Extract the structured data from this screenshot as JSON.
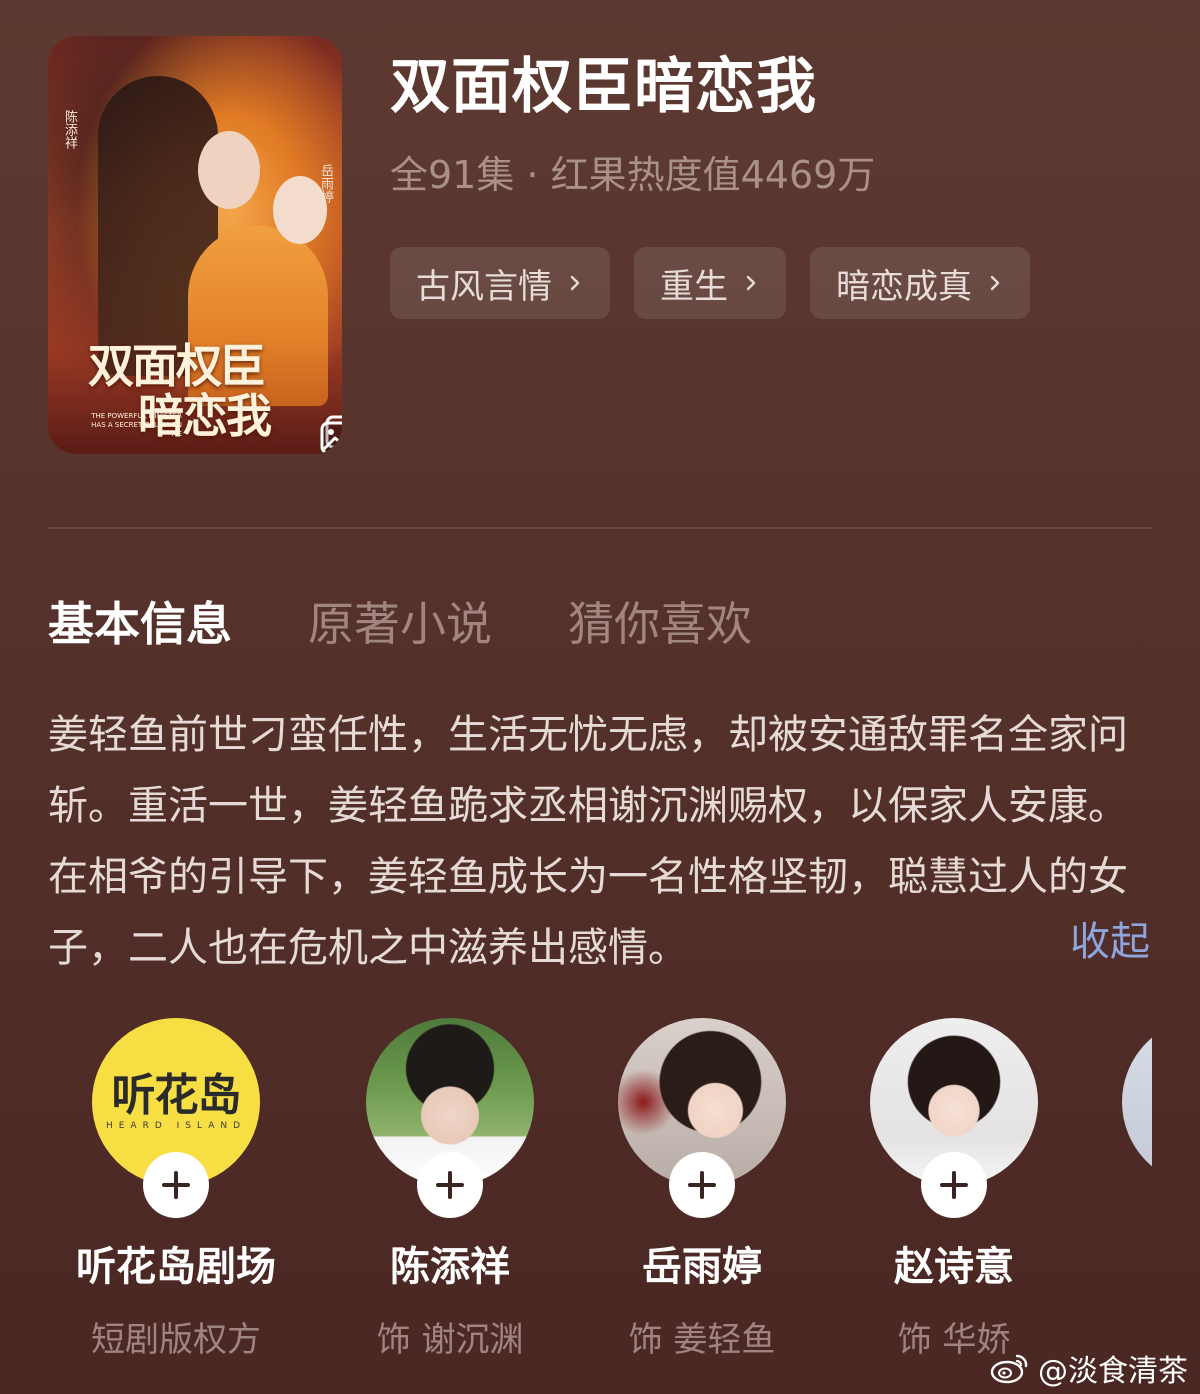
{
  "drama": {
    "title": "双面权臣暗恋我",
    "meta": "全91集 · 红果热度值4469万",
    "poster": {
      "calligraphy_line1": "双面权臣",
      "calligraphy_line2": "暗恋我",
      "english": "THE POWERFUL MINISTER HAS A SECRET CRUSH ON ME",
      "actor_male": "陈添祥",
      "actor_female": "岳雨婷"
    },
    "tags": [
      {
        "label": "古风言情"
      },
      {
        "label": "重生"
      },
      {
        "label": "暗恋成真"
      }
    ]
  },
  "tabs": [
    {
      "label": "基本信息",
      "active": true
    },
    {
      "label": "原著小说",
      "active": false
    },
    {
      "label": "猜你喜欢",
      "active": false
    }
  ],
  "description": "姜轻鱼前世刁蛮任性，生活无忧无虑，却被安通敌罪名全家问斩。重活一世，姜轻鱼跪求丞相谢沉渊赐权，以保家人安康。在相爷的引导下，姜轻鱼成长为一名性格坚韧，聪慧过人的女子，二人也在危机之中滋养出感情。",
  "collapse_label": "收起",
  "cast": [
    {
      "name": "听花岛剧场",
      "role": "短剧版权方",
      "logo_text": "听花岛",
      "logo_sub": "HEARD ISLAND"
    },
    {
      "name": "陈添祥",
      "role": "饰 谢沉渊"
    },
    {
      "name": "岳雨婷",
      "role": "饰 姜轻鱼"
    },
    {
      "name": "赵诗意",
      "role": "饰 华娇"
    },
    {
      "name": "",
      "role": ""
    }
  ],
  "watermark": "@淡食清茶",
  "colors": {
    "accent_link": "#8fa6dd",
    "logo_yellow": "#f7de43",
    "background": "#55312b"
  }
}
